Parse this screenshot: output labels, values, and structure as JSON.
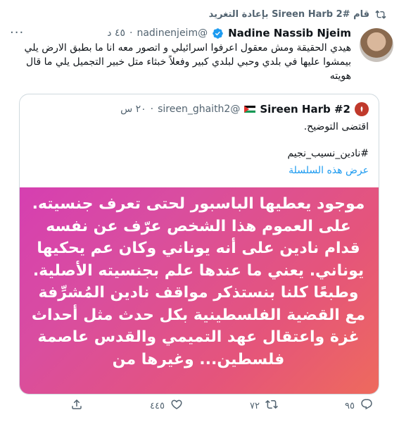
{
  "retweet_bar": {
    "text": "قام #2 Sireen Harb  بإعادة التغريد"
  },
  "tweet": {
    "author_name": "Nadine Nassib Njeim",
    "handle": "@nadinenjeim",
    "separator": "·",
    "time": "٤٥ د",
    "text": "هيدي الحقيقة ومش معقول اعرفوا اسرائيلي و اتصور معه انا ما بطبق الارض يلي بيمشوا عليها في بلدي وحبي لبلدي كبير وفعلاً خبثاء متل خبير التجميل يلي ما قال هويته"
  },
  "quote": {
    "author_name": "#2 Sireen Harb",
    "handle": "@sireen_ghaith2",
    "separator": "·",
    "time": "٢٠ س",
    "text": "اقتضى التوضيح.",
    "hashtag": "#نادين_نسيب_نجيم",
    "show_thread": "عرض هذه السلسلة",
    "image_text": "موجود يعطيها الباسبور لحتى تعرف جنسيته. على العموم هذا الشخص عرّف عن نفسه قدام نادين على أنه يوناني وكان عم يحكيها يوناني. يعني ما عندها علم بجنسيته الأصلية. وطبعًا كلنا بنستذكر مواقف نادين المُشرِّفة مع القضية الفلسطينية بكل حدث مثل أحداث غزة واعتقال عهد التميمي والقدس عاصمة فلسطين... وغيرها من"
  },
  "actions": {
    "reply_count": "٩٥",
    "retweet_count": "٧٢",
    "like_count": "٤٤٥",
    "share_label": ""
  },
  "colors": {
    "accent": "#1d9bf0",
    "muted": "#536471",
    "border": "#cfd9de",
    "image_gradient_start": "#d63fb1",
    "image_gradient_end": "#ee6a5d"
  }
}
